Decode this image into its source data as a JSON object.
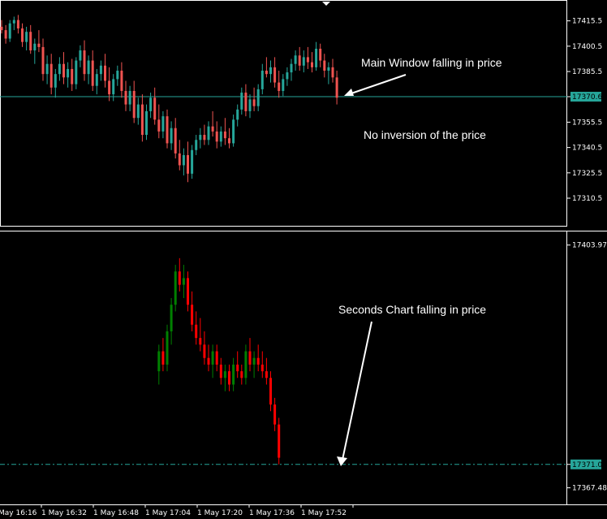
{
  "colors": {
    "background": "#000000",
    "frame": "#ffffff",
    "bull_main": "#26a69a",
    "bear_main": "#ef5350",
    "bull_seconds": "#008000",
    "bear_seconds": "#ff0000",
    "price_line": "#26a69a",
    "badge": "#26a69a"
  },
  "chart_data": [
    {
      "type": "candlestick",
      "panel": "main-window",
      "ylim": [
        17298,
        17424
      ],
      "y_ticks": [
        "17415.5",
        "17400.5",
        "17385.5",
        "17370.6",
        "17355.5",
        "17340.5",
        "17325.5",
        "17310.5"
      ],
      "current_price": "17370.6",
      "annotations": [
        "Main Window falling in price",
        "No inversion of the price"
      ],
      "candles": [
        [
          17412,
          17416,
          17408,
          17410
        ],
        [
          17410,
          17413,
          17402,
          17405
        ],
        [
          17405,
          17416,
          17403,
          17414
        ],
        [
          17414,
          17418,
          17410,
          17416
        ],
        [
          17416,
          17419,
          17408,
          17411
        ],
        [
          17411,
          17414,
          17400,
          17403
        ],
        [
          17403,
          17412,
          17398,
          17409
        ],
        [
          17409,
          17413,
          17396,
          17398
        ],
        [
          17398,
          17405,
          17390,
          17402
        ],
        [
          17402,
          17410,
          17397,
          17400
        ],
        [
          17400,
          17405,
          17380,
          17384
        ],
        [
          17384,
          17395,
          17378,
          17390
        ],
        [
          17390,
          17396,
          17372,
          17376
        ],
        [
          17376,
          17387,
          17370,
          17384
        ],
        [
          17384,
          17394,
          17380,
          17390
        ],
        [
          17390,
          17397,
          17378,
          17382
        ],
        [
          17382,
          17391,
          17376,
          17387
        ],
        [
          17387,
          17393,
          17374,
          17378
        ],
        [
          17378,
          17394,
          17375,
          17392
        ],
        [
          17392,
          17401,
          17388,
          17398
        ],
        [
          17398,
          17404,
          17380,
          17384
        ],
        [
          17384,
          17395,
          17378,
          17392
        ],
        [
          17392,
          17398,
          17374,
          17377
        ],
        [
          17377,
          17387,
          17372,
          17384
        ],
        [
          17384,
          17392,
          17380,
          17389
        ],
        [
          17389,
          17396,
          17376,
          17380
        ],
        [
          17380,
          17388,
          17368,
          17372
        ],
        [
          17372,
          17384,
          17368,
          17381
        ],
        [
          17381,
          17389,
          17377,
          17386
        ],
        [
          17386,
          17391,
          17370,
          17374
        ],
        [
          17374,
          17380,
          17362,
          17366
        ],
        [
          17366,
          17377,
          17362,
          17374
        ],
        [
          17374,
          17380,
          17355,
          17358
        ],
        [
          17358,
          17370,
          17354,
          17366
        ],
        [
          17366,
          17372,
          17344,
          17348
        ],
        [
          17348,
          17366,
          17345,
          17362
        ],
        [
          17362,
          17373,
          17358,
          17370
        ],
        [
          17370,
          17376,
          17354,
          17357
        ],
        [
          17357,
          17366,
          17346,
          17350
        ],
        [
          17350,
          17362,
          17346,
          17359
        ],
        [
          17359,
          17363,
          17340,
          17343
        ],
        [
          17343,
          17356,
          17339,
          17352
        ],
        [
          17352,
          17358,
          17334,
          17337
        ],
        [
          17337,
          17345,
          17327,
          17330
        ],
        [
          17330,
          17340,
          17324,
          17336
        ],
        [
          17336,
          17344,
          17320,
          17325
        ],
        [
          17325,
          17342,
          17322,
          17339
        ],
        [
          17339,
          17348,
          17336,
          17345
        ],
        [
          17345,
          17352,
          17340,
          17348
        ],
        [
          17348,
          17354,
          17342,
          17345
        ],
        [
          17345,
          17356,
          17342,
          17353
        ],
        [
          17353,
          17362,
          17347,
          17350
        ],
        [
          17350,
          17356,
          17340,
          17344
        ],
        [
          17344,
          17353,
          17341,
          17350
        ],
        [
          17350,
          17358,
          17342,
          17346
        ],
        [
          17346,
          17352,
          17340,
          17343
        ],
        [
          17343,
          17360,
          17341,
          17357
        ],
        [
          17357,
          17366,
          17353,
          17363
        ],
        [
          17363,
          17376,
          17360,
          17373
        ],
        [
          17373,
          17378,
          17359,
          17362
        ],
        [
          17362,
          17372,
          17358,
          17369
        ],
        [
          17369,
          17376,
          17362,
          17365
        ],
        [
          17365,
          17378,
          17362,
          17375
        ],
        [
          17375,
          17390,
          17372,
          17386
        ],
        [
          17386,
          17394,
          17382,
          17384
        ],
        [
          17384,
          17392,
          17379,
          17388
        ],
        [
          17388,
          17394,
          17376,
          17379
        ],
        [
          17379,
          17386,
          17370,
          17374
        ],
        [
          17374,
          17384,
          17371,
          17381
        ],
        [
          17381,
          17388,
          17377,
          17385
        ],
        [
          17385,
          17393,
          17380,
          17390
        ],
        [
          17390,
          17398,
          17386,
          17395
        ],
        [
          17395,
          17400,
          17386,
          17389
        ],
        [
          17389,
          17398,
          17385,
          17394
        ],
        [
          17394,
          17400,
          17387,
          17391
        ],
        [
          17391,
          17397,
          17385,
          17388
        ],
        [
          17388,
          17403,
          17386,
          17399
        ],
        [
          17399,
          17402,
          17388,
          17392
        ],
        [
          17392,
          17396,
          17382,
          17386
        ],
        [
          17386,
          17391,
          17378,
          17388
        ],
        [
          17388,
          17393,
          17379,
          17382
        ],
        [
          17382,
          17386,
          17366,
          17370
        ]
      ]
    },
    {
      "type": "candlestick",
      "panel": "seconds-chart",
      "ylim": [
        17365.6,
        17405.4
      ],
      "y_ticks": [
        "17403.97",
        "17371.00",
        "17367.48"
      ],
      "current_price": "17371.00",
      "annotations": [
        "Seconds Chart falling in price"
      ],
      "candles_start_index": 38,
      "candles": [
        [
          17385,
          17389,
          17383,
          17388
        ],
        [
          17388,
          17390,
          17385,
          17386
        ],
        [
          17386,
          17392,
          17385,
          17391
        ],
        [
          17391,
          17396,
          17389,
          17395
        ],
        [
          17395,
          17401,
          17394,
          17400
        ],
        [
          17400,
          17402,
          17397,
          17398
        ],
        [
          17398,
          17401,
          17396,
          17399
        ],
        [
          17399,
          17400,
          17394,
          17395
        ],
        [
          17395,
          17397,
          17391,
          17392
        ],
        [
          17392,
          17394,
          17389,
          17390
        ],
        [
          17390,
          17393,
          17388,
          17389
        ],
        [
          17389,
          17391,
          17386,
          17387
        ],
        [
          17387,
          17389,
          17385,
          17386
        ],
        [
          17386,
          17389,
          17384,
          17388
        ],
        [
          17388,
          17389,
          17385,
          17386
        ],
        [
          17386,
          17387,
          17383,
          17384
        ],
        [
          17384,
          17386,
          17382,
          17385
        ],
        [
          17385,
          17386,
          17382,
          17383
        ],
        [
          17383,
          17387,
          17382,
          17386
        ],
        [
          17386,
          17388,
          17384,
          17385
        ],
        [
          17385,
          17386,
          17383,
          17384
        ],
        [
          17384,
          17389,
          17383,
          17388
        ],
        [
          17388,
          17390,
          17385,
          17386
        ],
        [
          17386,
          17388,
          17384,
          17387
        ],
        [
          17387,
          17389,
          17385,
          17386
        ],
        [
          17386,
          17388,
          17384,
          17385
        ],
        [
          17385,
          17387,
          17383,
          17384
        ],
        [
          17384,
          17385,
          17379,
          17380
        ],
        [
          17380,
          17381,
          17376,
          17377
        ],
        [
          17377,
          17378,
          17371,
          17372
        ]
      ]
    }
  ],
  "x_ticks": [
    "May 16:16",
    "1 May 16:32",
    "1 May 16:48",
    "1 May 17:04",
    "1 May 17:20",
    "1 May 17:36",
    "1 May 17:52"
  ]
}
